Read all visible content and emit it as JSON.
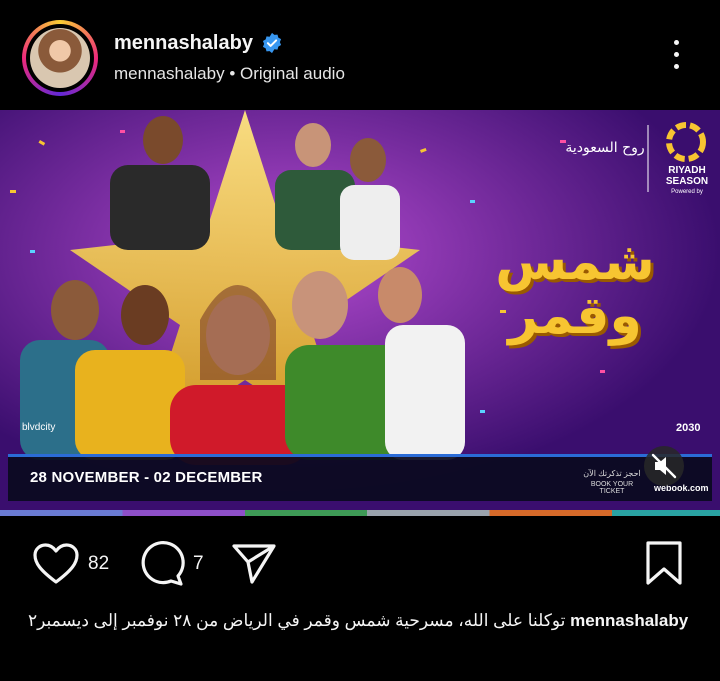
{
  "post": {
    "username": "mennashalaby",
    "subline_user": "mennashalaby",
    "subline_separator": "•",
    "subline_audio": "Original audio"
  },
  "poster": {
    "title_ar_line1": "شمس",
    "title_ar_line2": "وقمر",
    "dates": "28 NOVEMBER - 02 DECEMBER",
    "season_line1": "RIYADH",
    "season_line2": "SEASON",
    "season_powered": "Powered by",
    "saudi_ar": "روح السعودية",
    "book_ar": "احجز تذكرتك الآن",
    "book_en": "BOOK YOUR TICKET",
    "webook": "webook.com",
    "vision": "2030",
    "boulevard": "blvdcity"
  },
  "actions": {
    "likes": "82",
    "comments": "7"
  },
  "caption": {
    "author": "mennashalaby",
    "text": "توكلنا على الله، مسرحية شمس وقمر في الرياض من ٢٨ نوفمبر إلى ديسمبر٢"
  },
  "colors": {
    "background": "#000000",
    "verified": "#3897f0",
    "poster_bg": "#6a1f9a",
    "title_yellow": "#f7c531",
    "ticker_line": "#2b6cd6"
  }
}
